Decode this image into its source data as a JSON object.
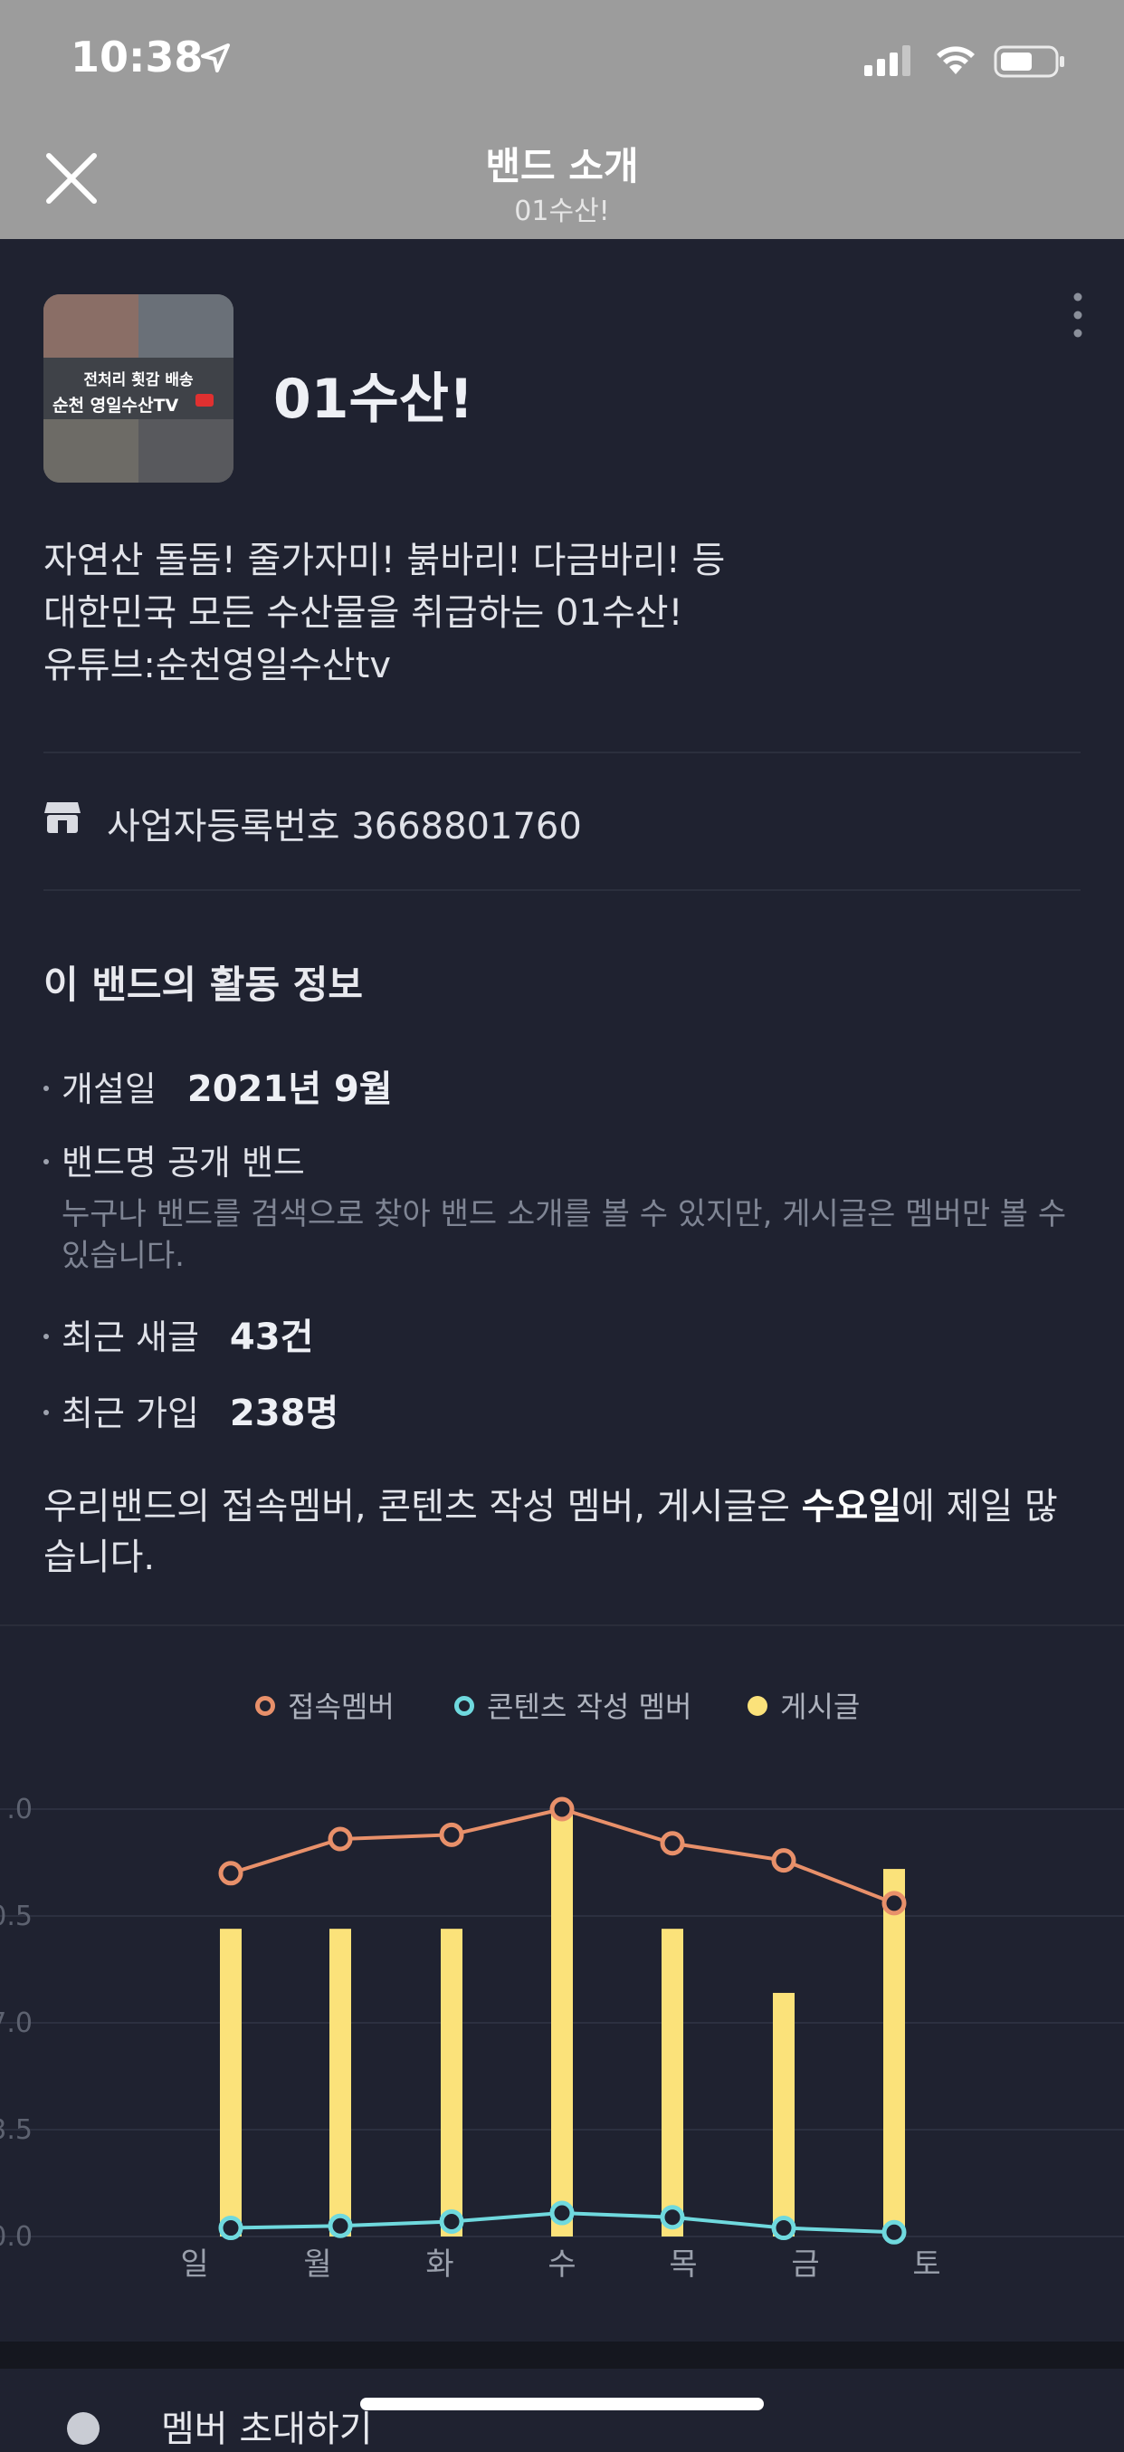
{
  "status_bar": {
    "time": "10:38"
  },
  "nav": {
    "title": "밴드 소개",
    "subtitle": "01수산!"
  },
  "band": {
    "name": "01수산!",
    "cover_text_line1": "전처리 횟감 배송",
    "cover_text_line2": "순천 영일수산TV",
    "description": [
      "자연산 돌돔! 줄가자미! 붉바리! 다금바리! 등",
      "대한민국 모든 수산물을 취급하는 01수산!",
      "유튜브:순천영일수산tv"
    ]
  },
  "business": {
    "label": "사업자등록번호 3668801760"
  },
  "activity": {
    "title": "이 밴드의 활동 정보",
    "opened_label": "개설일",
    "opened_value": "2021년 9월",
    "type_label": "밴드명 공개 밴드",
    "type_desc": "누구나 밴드를 검색으로 찾아 밴드 소개를 볼 수 있지만, 게시글은 멤버만 볼 수 있습니다.",
    "recent_posts_label": "최근 새글",
    "recent_posts_value": "43건",
    "recent_join_label": "최근 가입",
    "recent_join_value": "238명",
    "summary_prefix": "우리밴드의 접속멤버, 콘텐츠 작성 멤버, 게시글은 ",
    "summary_bold": "수요일",
    "summary_suffix": "에 제일 많습니다."
  },
  "colors": {
    "access": "#e8906a",
    "creator": "#6fd9de",
    "posts": "#fbe27a"
  },
  "chart_data": {
    "type": "bar",
    "categories": [
      "일",
      "월",
      "화",
      "수",
      "목",
      "금",
      "토"
    ],
    "legend": [
      "접속멤버",
      "콘텐츠 작성 멤버",
      "게시글"
    ],
    "yticks": [
      ".0",
      "0.5",
      "7.0",
      "3.5",
      "0.0"
    ],
    "series": [
      {
        "name": "게시글",
        "type": "bar",
        "values": [
          0.72,
          0.72,
          0.72,
          1.0,
          0.72,
          0.57,
          0.86
        ]
      },
      {
        "name": "접속멤버",
        "type": "line",
        "values": [
          0.85,
          0.93,
          0.94,
          1.0,
          0.92,
          0.88,
          0.78
        ]
      },
      {
        "name": "콘텐츠 작성 멤버",
        "type": "line",
        "values": [
          0.02,
          0.025,
          0.035,
          0.055,
          0.045,
          0.02,
          0.01
        ]
      }
    ],
    "ylim": [
      0,
      1
    ]
  },
  "bottom": {
    "invite_label": "멤버 초대하기"
  }
}
